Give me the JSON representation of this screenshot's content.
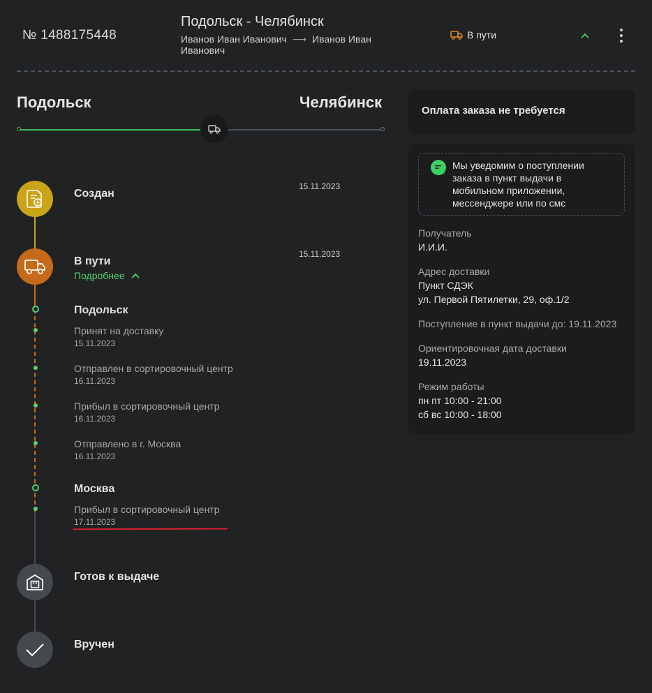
{
  "header": {
    "order_number": "№ 1488175448",
    "route_title": "Подольск - Челябинск",
    "sender": "Иванов Иван Иванович",
    "receiver": "Иванов Иван Иванович",
    "status": "В пути"
  },
  "route": {
    "from_city": "Подольск",
    "to_city": "Челябинск",
    "progress_fraction": 0.5
  },
  "timeline": {
    "created": {
      "title": "Создан",
      "date": "15.11.2023"
    },
    "in_transit": {
      "title": "В пути",
      "date": "15.11.2023",
      "details_label": "Подробнее"
    },
    "ready": {
      "title": "Готов к выдаче"
    },
    "delivered": {
      "title": "Вручен"
    },
    "cities": [
      {
        "name": "Подольск",
        "events": [
          {
            "text": "Принят на доставку",
            "date": "15.11.2023"
          },
          {
            "text": "Отправлен в сортировочный центр",
            "date": "16.11.2023"
          },
          {
            "text": "Прибыл в сортировочный центр",
            "date": "16.11.2023"
          },
          {
            "text": "Отправлено в г. Москва",
            "date": "16.11.2023"
          }
        ]
      },
      {
        "name": "Москва",
        "events": [
          {
            "text": "Прибыл в сортировочный центр",
            "date": "17.11.2023"
          }
        ]
      }
    ]
  },
  "payment": {
    "text": "Оплата заказа не требуется"
  },
  "info": {
    "notice": "Мы уведомим о поступлении заказа в пункт выдачи в мобильном приложении, мессенджере или по смс",
    "recipient_label": "Получатель",
    "recipient_value": "И.И.И.",
    "address_label": "Адрес доставки",
    "address_line1": "Пункт СДЭК",
    "address_line2": "ул. Первой Пятилетки, 29, оф.1/2",
    "arrival_deadline": "Поступление в пункт выдачи до: 19.11.2023",
    "eta_label": "Ориентировочная дата доставки",
    "eta_value": "19.11.2023",
    "hours_label": "Режим работы",
    "hours_weekdays": "пн пт 10:00 - 21:00",
    "hours_weekend": "сб вс 10:00 - 18:00"
  },
  "colors": {
    "background": "#202224",
    "accent_green": "#54d36c",
    "created_yellow": "#c9a318",
    "transit_orange": "#c46a18",
    "status_orange": "#e0892a",
    "highlight_red": "#d8202e"
  }
}
